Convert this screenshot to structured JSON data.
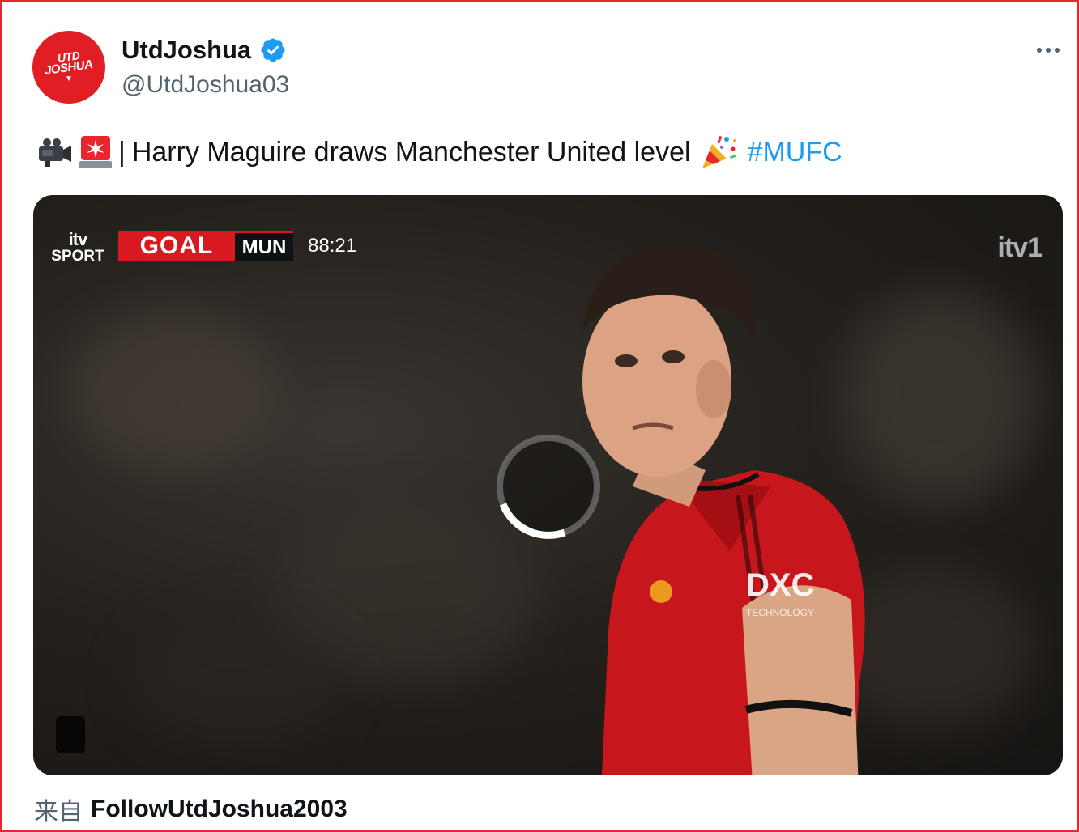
{
  "colors": {
    "frame": "#e8262d",
    "link": "#1d9bf0",
    "secondary_text": "#536471",
    "verified_badge": "#1d9bf0",
    "goal_red": "#d81921",
    "avatar_red": "#e01e24"
  },
  "author": {
    "display_name": "UtdJoshua",
    "handle": "@UtdJoshua03",
    "avatar_text_line1": "UTD",
    "avatar_text_line2": "JOSHUA",
    "verified_icon": "verified-badge-icon"
  },
  "menu": {
    "more_icon": "more-horizontal-icon"
  },
  "tweet": {
    "emojis": [
      "video-camera-emoji",
      "police-light-emoji",
      "party-popper-emoji"
    ],
    "separator": "|",
    "text": "Harry Maguire draws Manchester United level",
    "hashtag": "#MUFC"
  },
  "video": {
    "broadcaster_top": "itv",
    "broadcaster_bottom": "SPORT",
    "scorebug_event": "GOAL",
    "scorebug_team": "MUN",
    "match_clock": "88:21",
    "channel_logo": "itv1",
    "loading_icon": "loading-spinner-icon",
    "pause_icon": "pause-button-icon"
  },
  "footer": {
    "source_prefix": "来自",
    "source_name": "FollowUtdJoshua2003"
  }
}
